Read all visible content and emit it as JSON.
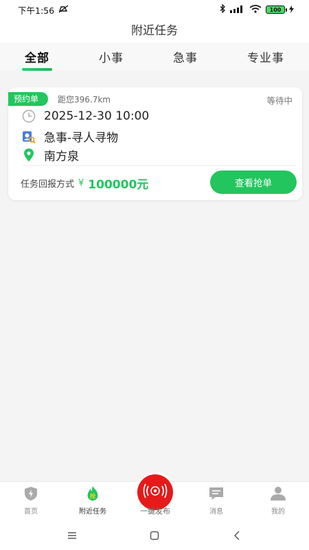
{
  "status_bar": {
    "time": "下午1:56",
    "battery": "100"
  },
  "header": {
    "title": "附近任务"
  },
  "tabs": [
    {
      "label": "全部",
      "active": true
    },
    {
      "label": "小事",
      "active": false
    },
    {
      "label": "急事",
      "active": false
    },
    {
      "label": "专业事",
      "active": false
    }
  ],
  "task": {
    "badge": "预约单",
    "distance": "距您396.7km",
    "status": "等待中",
    "datetime": "2025-12-30 10:00",
    "category": "急事-寻人寻物",
    "location": "南方泉",
    "reward_label": "任务回报方式",
    "currency": "¥",
    "amount": "100000元",
    "action": "查看抢单"
  },
  "bottom_nav": {
    "home": "首页",
    "nearby": "附近任务",
    "publish": "一键发布",
    "messages": "消息",
    "mine": "我的"
  },
  "colors": {
    "accent": "#22c55e",
    "publish": "#e61a1a"
  }
}
